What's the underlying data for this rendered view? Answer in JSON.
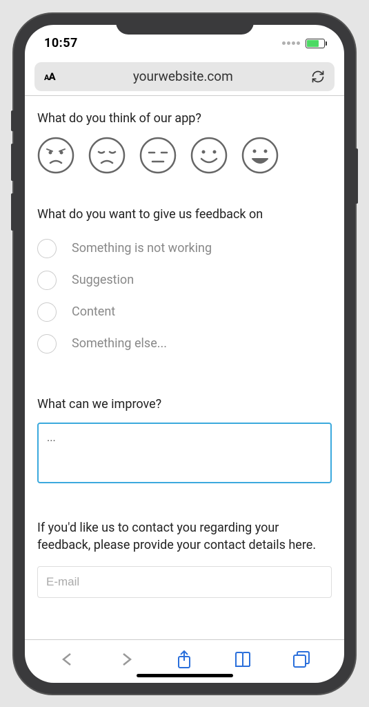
{
  "status": {
    "time": "10:57"
  },
  "browser": {
    "url": "yourwebsite.com"
  },
  "form": {
    "rating_question": "What do you think of our app?",
    "category_question": "What do you want to give us feedback on",
    "categories": [
      "Something is not working",
      "Suggestion",
      "Content",
      "Something else..."
    ],
    "improve_question": "What can we improve?",
    "improve_value": "...",
    "contact_question": "If you'd like us to contact you regarding your feedback, please provide your contact details here.",
    "email_placeholder": "E-mail"
  }
}
